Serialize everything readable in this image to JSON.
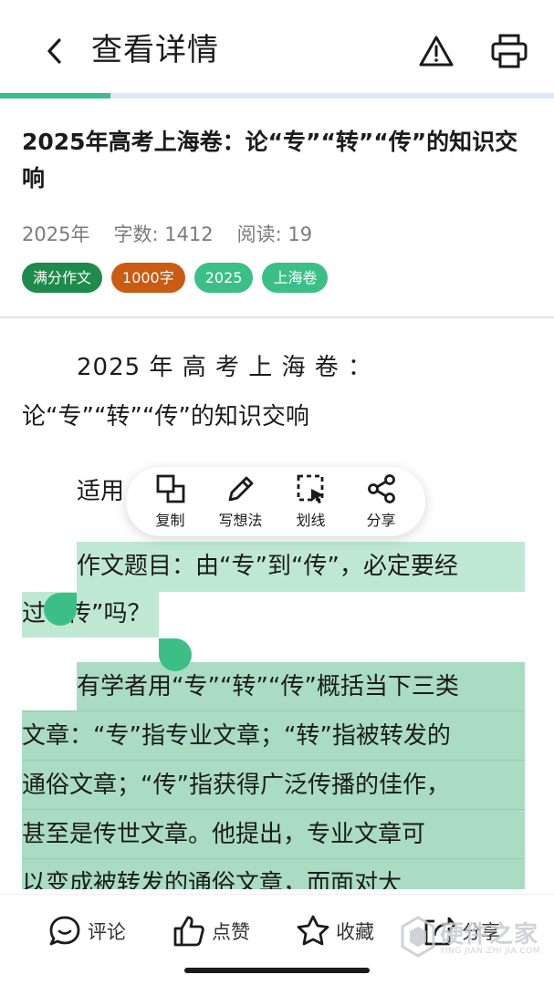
{
  "header": {
    "title": "查看详情",
    "back_icon": "chevron-left-icon",
    "report_icon": "warning-triangle-icon",
    "print_icon": "printer-icon",
    "reading_progress": 0.2
  },
  "article": {
    "title": "2025年高考上海卷：论“专”“转”“传”的知识交响",
    "meta": {
      "year": "2025年",
      "word_count": "字数: 1412",
      "reads": "阅读: 19"
    },
    "tags": [
      {
        "label": "满分作文",
        "color": "#1e8a4c"
      },
      {
        "label": "1000字",
        "color": "#c95b12"
      },
      {
        "label": "2025",
        "color": "#3cbf86"
      },
      {
        "label": "上海卷",
        "color": "#3cbf86"
      }
    ]
  },
  "content": {
    "lines": [
      "2025 年 高 考 上 海 卷 ：",
      "论“专”“转”“传”的知识交响",
      "适用",
      "作文题目：由“专”到“传”，必定要经",
      "过",
      "传”吗？",
      "有学者用“专”“转”“传”概括当下三类",
      "文章：“专”指专业文章；“转”指被转发的",
      "通俗文章；“传”指获得广泛传播的佳作，",
      "甚至是传世文章。他提出，专业文章可",
      "以变成被转发的通俗文章，而面对大"
    ]
  },
  "selection_menu": {
    "items": [
      {
        "label": "复制",
        "icon": "copy-icon"
      },
      {
        "label": "写想法",
        "icon": "pencil-icon"
      },
      {
        "label": "划线",
        "icon": "underline-select-icon"
      },
      {
        "label": "分享",
        "icon": "share-icon"
      }
    ]
  },
  "bottom_bar": {
    "comment": "评论",
    "like": "点赞",
    "favorite": "收藏",
    "share": "分享"
  },
  "watermark": {
    "title": "硬件之家",
    "subtitle": "YING JIAN ZHI JIA.COM"
  },
  "colors": {
    "accent": "#3cbf86",
    "highlight": "#bfe8d4"
  }
}
